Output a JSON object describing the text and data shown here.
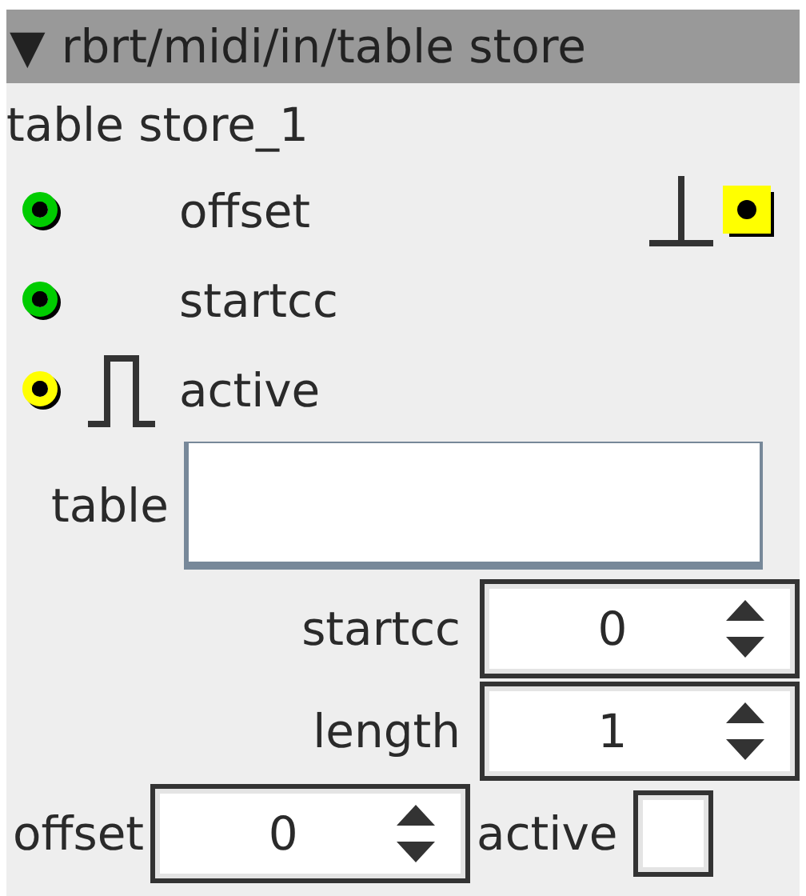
{
  "header": {
    "glyph": "▼",
    "title": "rbrt/midi/in/table store"
  },
  "instance_name": "table store_1",
  "inlets": [
    {
      "label": "offset",
      "color": "#00cc00",
      "trigger": false
    },
    {
      "label": "startcc",
      "color": "#00cc00",
      "trigger": false
    },
    {
      "label": "active",
      "color": "#ffff00",
      "trigger": true
    }
  ],
  "outlets": [
    {
      "kind": "bool"
    }
  ],
  "table_field": {
    "label": "table"
  },
  "param_rows": [
    [
      {
        "kind": "spinbox",
        "label": "startcc",
        "value": "0"
      }
    ],
    [
      {
        "kind": "spinbox",
        "label": "length",
        "value": "1"
      }
    ],
    [
      {
        "kind": "spinbox",
        "label": "offset",
        "value": "0"
      },
      {
        "kind": "checkbox",
        "label": "active",
        "checked": false
      }
    ]
  ]
}
